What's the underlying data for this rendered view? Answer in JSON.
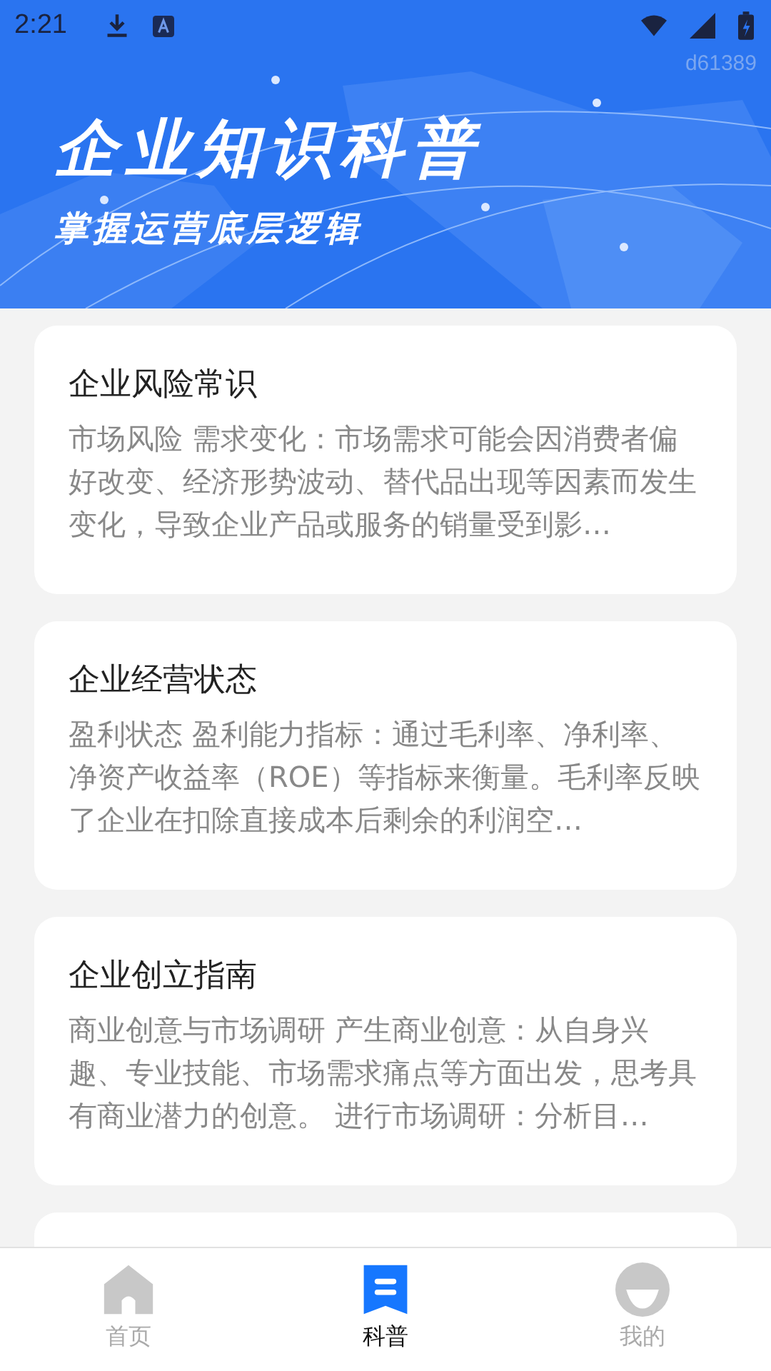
{
  "status_bar": {
    "time": "2:21"
  },
  "header": {
    "code": "d61389",
    "title": "企业知识科普",
    "subtitle": "掌握运营底层逻辑"
  },
  "cards": [
    {
      "kind": "article",
      "title": "企业风险常识",
      "body": "市场风险 需求变化：市场需求可能会因消费者偏好改变、经济形势波动、替代品出现等因素而发生变化，导致企业产品或服务的销量受到影…"
    },
    {
      "kind": "article",
      "title": "企业经营状态",
      "body": "盈利状态 盈利能力指标：通过毛利率、净利率、净资产收益率（ROE）等指标来衡量。毛利率反映了企业在扣除直接成本后剩余的利润空…"
    },
    {
      "kind": "article",
      "title": "企业创立指南",
      "body": "商业创意与市场调研 产生商业创意：从自身兴趣、专业技能、市场需求痛点等方面出发，思考具有商业潜力的创意。 进行市场调研：分析目…"
    },
    {
      "kind": "partial"
    }
  ],
  "tabs": [
    {
      "label": "首页",
      "kind": "home",
      "selected": false
    },
    {
      "label": "科普",
      "kind": "doc",
      "selected": true
    },
    {
      "label": "我的",
      "kind": "user",
      "selected": false
    }
  ]
}
